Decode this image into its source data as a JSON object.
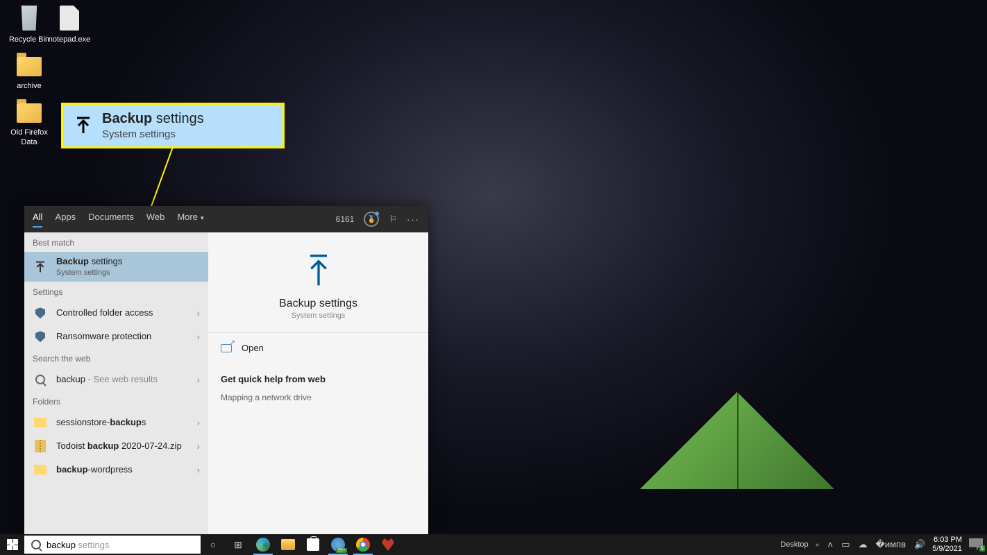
{
  "desktop_icons": {
    "recycle_bin": "Recycle Bin",
    "notepad": "notepad.exe",
    "archive": "archive",
    "old_firefox": "Old Firefox Data"
  },
  "callout": {
    "title_bold": "Backup",
    "title_rest": " settings",
    "subtitle": "System settings"
  },
  "search_panel": {
    "tabs": {
      "all": "All",
      "apps": "Apps",
      "documents": "Documents",
      "web": "Web",
      "more": "More"
    },
    "points": "6161",
    "sections": {
      "best_match": "Best match",
      "settings": "Settings",
      "search_web": "Search the web",
      "folders": "Folders"
    },
    "best_match": {
      "title_bold": "Backup",
      "title_rest": " settings",
      "subtitle": "System settings"
    },
    "settings_items": {
      "cfa": "Controlled folder access",
      "ransomware": "Ransomware protection"
    },
    "web_item": {
      "term": "backup",
      "suffix": " - See web results"
    },
    "folders": {
      "f1_pre": "sessionstore-",
      "f1_bold": "backup",
      "f1_post": "s",
      "f2_pre": "Todoist ",
      "f2_bold": "backup",
      "f2_post": " 2020-07-24.zip",
      "f3_bold": "backup",
      "f3_post": "-wordpress"
    },
    "preview": {
      "title": "Backup settings",
      "subtitle": "System settings",
      "open": "Open",
      "help_hdr": "Get quick help from web",
      "help_link": "Mapping a network drive"
    }
  },
  "taskbar": {
    "search_typed": "backup",
    "search_suggestion": " settings",
    "desktop_label": "Desktop",
    "chevrons": "»",
    "time": "6:03 PM",
    "date": "5/9/2021",
    "notif_count": "5"
  }
}
